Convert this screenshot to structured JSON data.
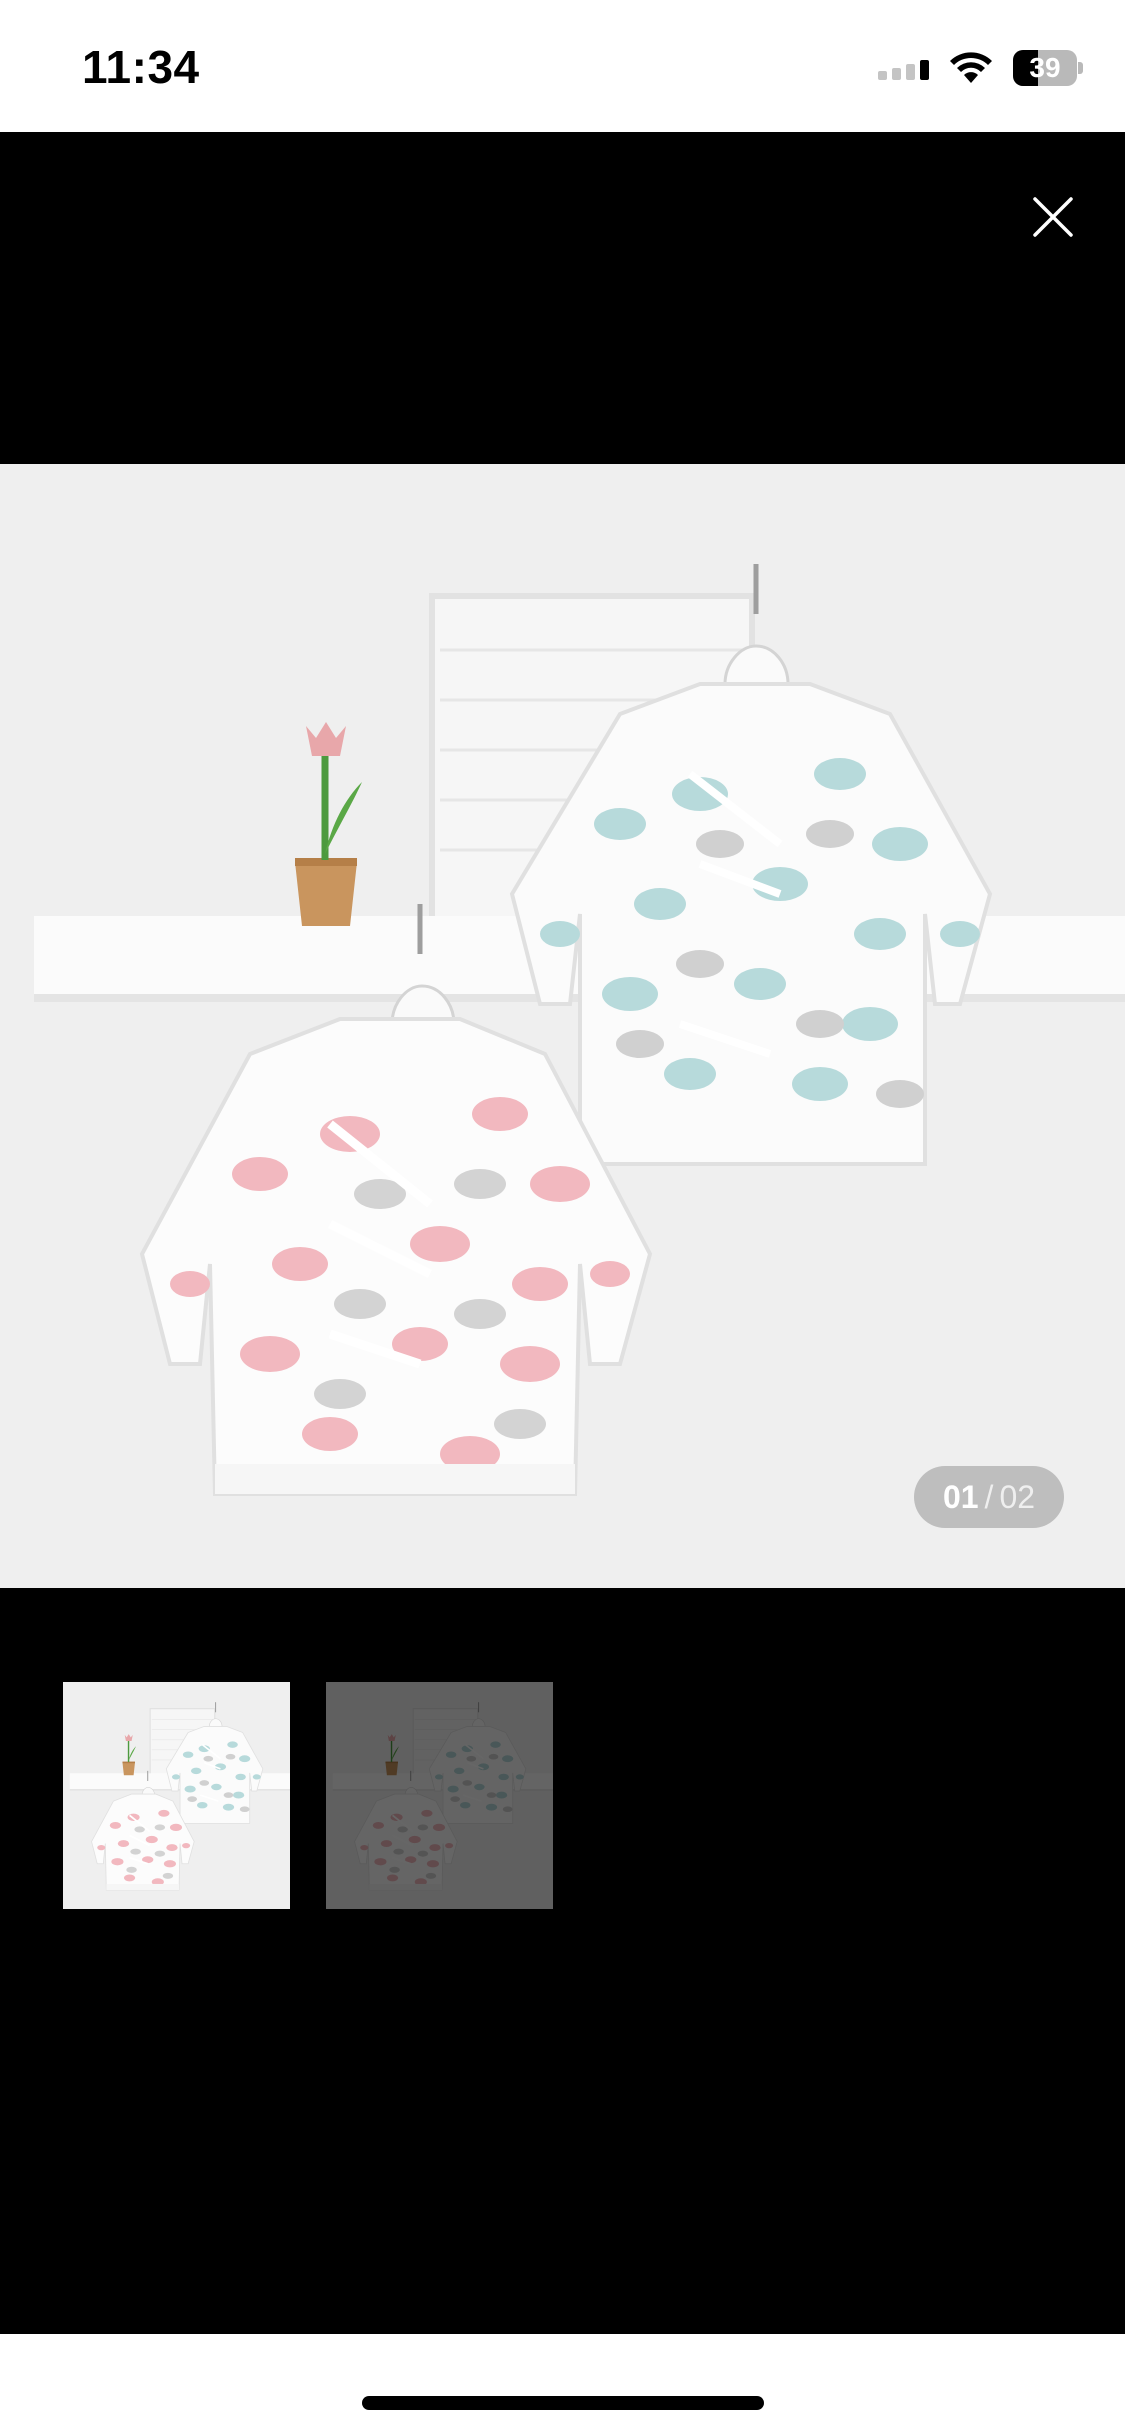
{
  "status_bar": {
    "time": "11:34",
    "battery_level": "39",
    "icons": [
      "cellular-signal-icon",
      "wifi-icon",
      "battery-icon"
    ]
  },
  "viewer": {
    "close_icon": "close-icon",
    "counter": {
      "current": "01",
      "separator": "/",
      "total": "02"
    },
    "thumbnails": [
      {
        "selected": true
      },
      {
        "selected": false
      }
    ]
  },
  "colors": {
    "background": "#000000",
    "photo_background": "#f1f1f1",
    "counter_pill": "#969696"
  }
}
